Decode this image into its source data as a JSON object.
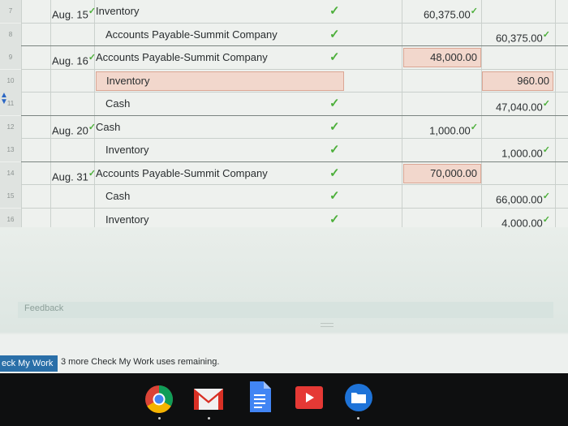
{
  "journal": {
    "rows": [
      {
        "num": "7",
        "date": "Aug. 15",
        "account": "Inventory",
        "indent": false,
        "debit": "60,375.00",
        "credit": "",
        "check_post": true,
        "check_date": true,
        "check_debit": true,
        "check_credit": false,
        "hl_acct": false,
        "hl_debit": false,
        "hl_credit": false
      },
      {
        "num": "8",
        "date": "",
        "account": "Accounts Payable-Summit Company",
        "indent": true,
        "debit": "",
        "credit": "60,375.00",
        "check_post": true,
        "check_date": false,
        "check_debit": false,
        "check_credit": true,
        "hl_acct": false,
        "hl_debit": false,
        "hl_credit": false
      },
      {
        "num": "9",
        "date": "Aug. 16",
        "account": "Accounts Payable-Summit Company",
        "indent": false,
        "debit": "48,000.00",
        "credit": "",
        "check_post": true,
        "check_date": true,
        "check_debit": false,
        "check_credit": false,
        "hl_acct": false,
        "hl_debit": true,
        "hl_credit": false
      },
      {
        "num": "10",
        "date": "",
        "account": "Inventory",
        "indent": true,
        "debit": "",
        "credit": "960.00",
        "check_post": false,
        "check_date": false,
        "check_debit": false,
        "check_credit": false,
        "hl_acct": true,
        "hl_debit": false,
        "hl_credit": true
      },
      {
        "num": "11",
        "date": "",
        "account": "Cash",
        "indent": true,
        "debit": "",
        "credit": "47,040.00",
        "check_post": true,
        "check_date": false,
        "check_debit": false,
        "check_credit": true,
        "hl_acct": false,
        "hl_debit": false,
        "hl_credit": false
      },
      {
        "num": "12",
        "date": "Aug. 20",
        "account": "Cash",
        "indent": false,
        "debit": "1,000.00",
        "credit": "",
        "check_post": true,
        "check_date": true,
        "check_debit": true,
        "check_credit": false,
        "hl_acct": false,
        "hl_debit": false,
        "hl_credit": false
      },
      {
        "num": "13",
        "date": "",
        "account": "Inventory",
        "indent": true,
        "debit": "",
        "credit": "1,000.00",
        "check_post": true,
        "check_date": false,
        "check_debit": false,
        "check_credit": true,
        "hl_acct": false,
        "hl_debit": false,
        "hl_credit": false
      },
      {
        "num": "14",
        "date": "Aug. 31",
        "account": "Accounts Payable-Summit Company",
        "indent": false,
        "debit": "70,000.00",
        "credit": "",
        "check_post": true,
        "check_date": true,
        "check_debit": false,
        "check_credit": false,
        "hl_acct": false,
        "hl_debit": true,
        "hl_credit": false
      },
      {
        "num": "15",
        "date": "",
        "account": "Cash",
        "indent": true,
        "debit": "",
        "credit": "66,000.00",
        "check_post": true,
        "check_date": false,
        "check_debit": false,
        "check_credit": true,
        "hl_acct": false,
        "hl_debit": false,
        "hl_credit": false
      },
      {
        "num": "16",
        "date": "",
        "account": "Inventory",
        "indent": true,
        "debit": "",
        "credit": "4,000.00",
        "check_post": true,
        "check_date": false,
        "check_debit": false,
        "check_credit": true,
        "hl_acct": false,
        "hl_debit": false,
        "hl_credit": false
      }
    ]
  },
  "feedback": {
    "label": "Feedback"
  },
  "footer": {
    "check_button": "eck My Work",
    "remaining": "3 more Check My Work uses remaining."
  },
  "icons": {
    "check": "check-icon",
    "row_arrow": "row-move-icon",
    "apps": [
      "chrome-icon",
      "gmail-icon",
      "docs-icon",
      "youtube-icon",
      "files-icon"
    ]
  },
  "colors": {
    "check_green": "#4caf3a",
    "highlight_fill": "#f2d7cc",
    "button_blue": "#2a6fa8",
    "taskbar": "#0e0f10"
  }
}
